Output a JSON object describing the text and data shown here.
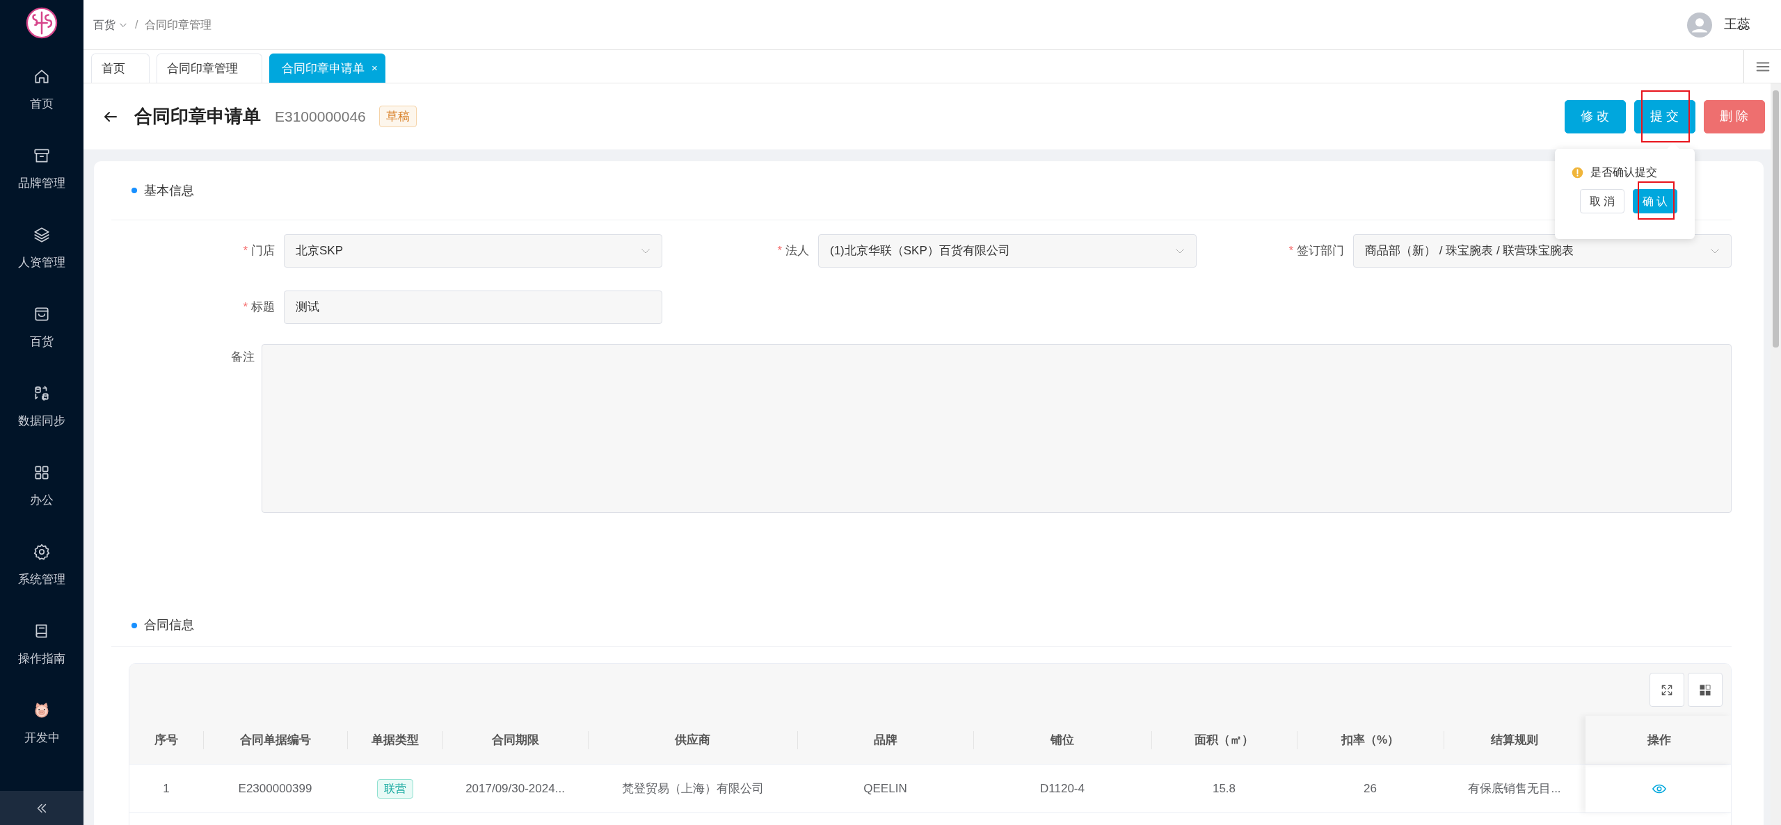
{
  "sidebar": {
    "items": [
      {
        "label": "首页"
      },
      {
        "label": "品牌管理"
      },
      {
        "label": "人资管理"
      },
      {
        "label": "百货"
      },
      {
        "label": "数据同步"
      },
      {
        "label": "办公"
      },
      {
        "label": "系统管理"
      },
      {
        "label": "操作指南"
      },
      {
        "label": "开发中"
      }
    ]
  },
  "header": {
    "breadcrumb": [
      {
        "label": "百货",
        "dropdown": true
      },
      {
        "label": "/",
        "dropdown": false
      },
      {
        "label": "合同印章管理",
        "dropdown": false
      }
    ],
    "user": {
      "name": "王蕊"
    }
  },
  "tabs": [
    {
      "label": "首页",
      "selected": false,
      "closable": false
    },
    {
      "label": "合同印章管理",
      "selected": false,
      "closable": false
    },
    {
      "label": "合同印章申请单",
      "selected": true,
      "closable": true,
      "close": "×"
    }
  ],
  "page": {
    "title": "合同印章申请单",
    "doc_no": "E3100000046",
    "status": "草稿",
    "buttons": [
      {
        "label": "修 改",
        "kind": "primary",
        "highlighted": false
      },
      {
        "label": "提 交",
        "kind": "primary",
        "highlighted": true
      },
      {
        "label": "删 除",
        "kind": "danger",
        "highlighted": false
      }
    ]
  },
  "popconfirm": {
    "message": "是否确认提交",
    "buttons": [
      {
        "label": "取 消",
        "kind": "default",
        "highlighted": false
      },
      {
        "label": "确 认",
        "kind": "primary",
        "highlighted": true
      }
    ]
  },
  "basic_info": {
    "title": "基本信息",
    "required_mark": "*",
    "fields": [
      {
        "label": "门店",
        "required": true,
        "kind": "select",
        "value": "北京SKP"
      },
      {
        "label": "法人",
        "required": true,
        "kind": "select",
        "value": "(1)北京华联（SKP）百货有限公司"
      },
      {
        "label": "签订部门",
        "required": true,
        "kind": "select",
        "value": "商品部（新） / 珠宝腕表 / 联营珠宝腕表"
      },
      {
        "label": "标题",
        "required": true,
        "kind": "input",
        "value": "测试"
      },
      {
        "label": "备注",
        "required": false,
        "kind": "textarea"
      }
    ]
  },
  "contract_info": {
    "title": "合同信息",
    "table": {
      "columns": [
        "序号",
        "合同单据编号",
        "单据类型",
        "合同期限",
        "供应商",
        "品牌",
        "铺位",
        "面积（㎡）",
        "扣率（%）",
        "结算规则",
        "操作"
      ],
      "rows": [
        {
          "cells": [
            {
              "text": "1",
              "kind": "text"
            },
            {
              "text": "E2300000399",
              "kind": "text"
            },
            {
              "text": "联营",
              "kind": "tag"
            },
            {
              "text": "2017/09/30-2024...",
              "kind": "text"
            },
            {
              "text": "梵登贸易（上海）有限公司",
              "kind": "text"
            },
            {
              "text": "QEELIN",
              "kind": "text"
            },
            {
              "text": "D1120-4",
              "kind": "text"
            },
            {
              "text": "15.8",
              "kind": "text"
            },
            {
              "text": "26",
              "kind": "text"
            },
            {
              "text": "有保底销售无目...",
              "kind": "text"
            }
          ]
        }
      ]
    }
  }
}
